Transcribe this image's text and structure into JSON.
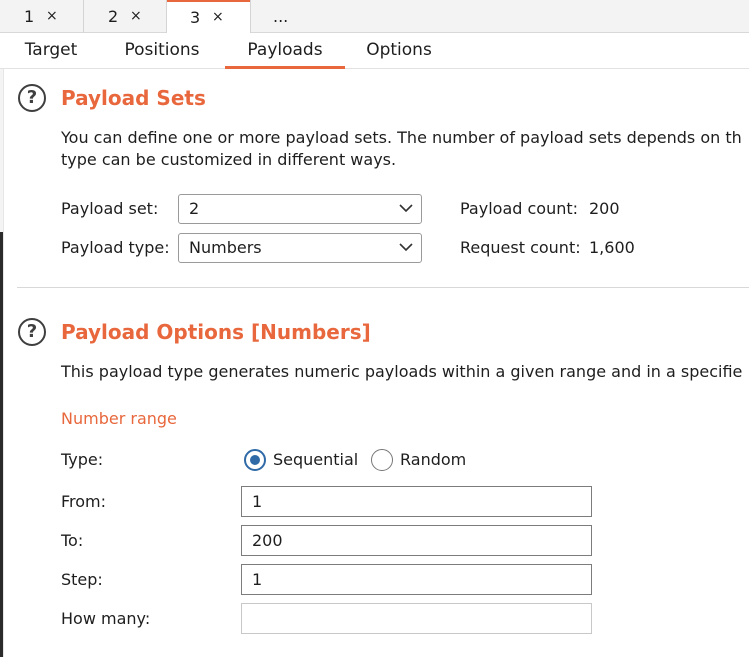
{
  "top_tabs": [
    {
      "label": "1",
      "close": "×"
    },
    {
      "label": "2",
      "close": "×"
    },
    {
      "label": "3",
      "close": "×"
    },
    {
      "label": "..."
    }
  ],
  "sub_tabs": [
    "Target",
    "Positions",
    "Payloads",
    "Options"
  ],
  "active_sub_tab": "Payloads",
  "payload_sets": {
    "help": "?",
    "title": "Payload Sets",
    "desc_line1": "You can define one or more payload sets. The number of payload sets depends on th",
    "desc_line2": "type can be customized in different ways.",
    "set_label": "Payload set:",
    "set_value": "2",
    "type_label": "Payload type:",
    "type_value": "Numbers",
    "payload_count_label": "Payload count:",
    "payload_count": "200",
    "request_count_label": "Request count:",
    "request_count": "1,600"
  },
  "payload_options": {
    "help": "?",
    "title": "Payload Options [Numbers]",
    "desc": "This payload type generates numeric payloads within a given range and in a specifie",
    "subheading": "Number range",
    "type_label": "Type:",
    "type_options": [
      "Sequential",
      "Random"
    ],
    "type_selected": "Sequential",
    "from_label": "From:",
    "from_value": "1",
    "to_label": "To:",
    "to_value": "200",
    "step_label": "Step:",
    "step_value": "1",
    "how_many_label": "How many:",
    "how_many_value": ""
  },
  "colors": {
    "accent": "#e8673c",
    "radio_selected": "#2f6aa7"
  }
}
